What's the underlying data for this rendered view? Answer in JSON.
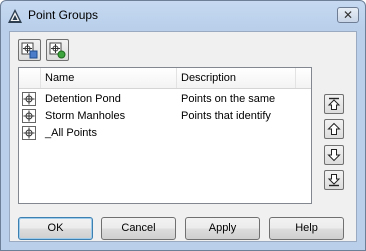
{
  "window": {
    "title": "Point Groups"
  },
  "list": {
    "columns": [
      "Name",
      "Description"
    ],
    "rows": [
      {
        "name": "Detention Pond",
        "description": "Points on the same"
      },
      {
        "name": "Storm Manholes",
        "description": "Points that identify"
      },
      {
        "name": "_All Points",
        "description": ""
      }
    ]
  },
  "buttons": {
    "ok": "OK",
    "cancel": "Cancel",
    "apply": "Apply",
    "help": "Help"
  },
  "icons": {
    "app": "autocad-triangle-icon",
    "close": "close-icon",
    "tool1": "point-group-properties-icon",
    "tool2": "point-group-update-icon",
    "row": "point-group-icon",
    "move_top": "move-to-top-icon",
    "move_up": "move-up-icon",
    "move_down": "move-down-icon",
    "move_bottom": "move-to-bottom-icon"
  },
  "colors": {
    "title_bar": "#c6d9f1",
    "client": "#f0f0f0",
    "default_border": "#3c7fb1"
  }
}
